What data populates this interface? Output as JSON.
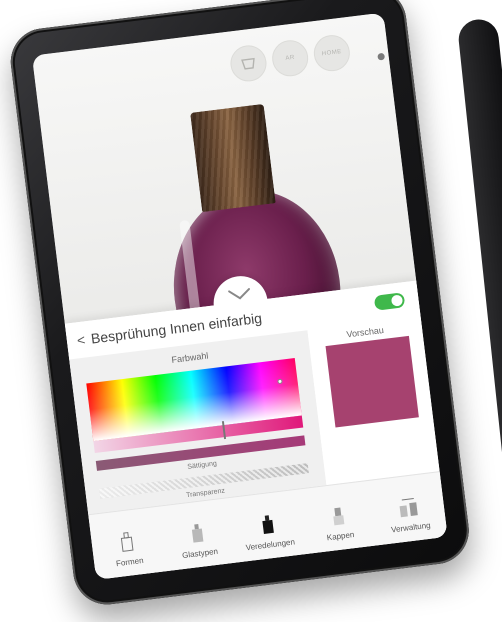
{
  "top_buttons": [
    {
      "name": "basket",
      "label": ""
    },
    {
      "name": "ar",
      "label": "AR"
    },
    {
      "name": "home",
      "label": "HOME"
    }
  ],
  "panel": {
    "title": "Besprühung Innen einfarbig",
    "toggle_on": true,
    "color_section_label": "Farbwahl",
    "preview_label": "Vorschau",
    "saturation_label": "Sättigung",
    "transparency_label": "Transparenz",
    "preview_color": "#a6426f"
  },
  "tabs": [
    {
      "id": "formen",
      "label": "Formen"
    },
    {
      "id": "glastypen",
      "label": "Glastypen"
    },
    {
      "id": "veredelungen",
      "label": "Veredelungen"
    },
    {
      "id": "kappen",
      "label": "Kappen"
    },
    {
      "id": "verwaltung",
      "label": "Verwaltung"
    }
  ],
  "colors": {
    "toggle_on": "#3fb84b",
    "selected_hue": "#e0187a",
    "bottle_liquid": "#6a1f4c"
  }
}
